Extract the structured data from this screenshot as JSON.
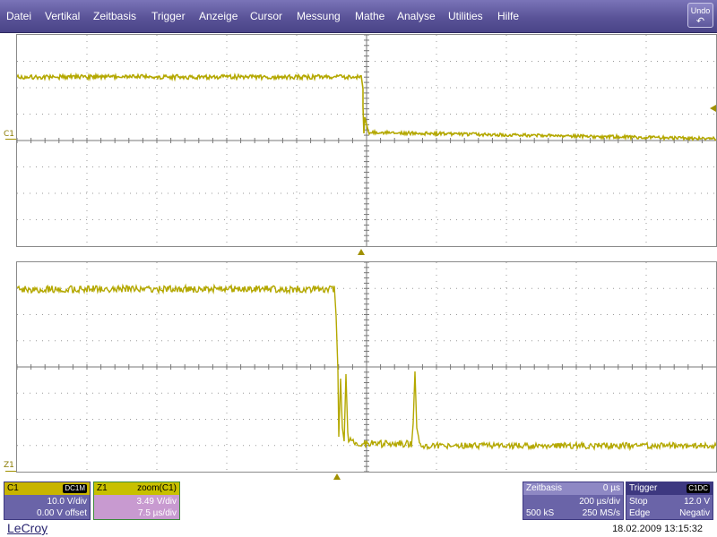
{
  "menu": [
    "Datei",
    "Vertikal",
    "Zeitbasis",
    "Trigger",
    "Anzeige",
    "Cursor",
    "Messung",
    "Mathe",
    "Analyse",
    "Utilities",
    "Hilfe"
  ],
  "undo_label": "Undo",
  "channel_labels": {
    "c1": "C1",
    "z1": "Z1"
  },
  "c1": {
    "name": "C1",
    "coupling": "DC1M",
    "scale": "10.0 V/div",
    "offset": "0.00 V offset"
  },
  "z1": {
    "name": "Z1",
    "source": "zoom(C1)",
    "scale": "3.49 V/div",
    "timebase": "7.5 µs/div"
  },
  "timebase": {
    "title": "Zeitbasis",
    "delay": "0 µs",
    "per_div": "200 µs/div",
    "samples": "500 kS",
    "rate": "250 MS/s"
  },
  "trigger": {
    "title": "Trigger",
    "source": "C1DC",
    "mode": "Stop",
    "level": "12.0 V",
    "type": "Edge",
    "slope": "Negativ"
  },
  "brand": "LeCroy",
  "timestamp": "18.02.2009 13:15:32",
  "colors": {
    "trace": "#b4a800",
    "menu": "#5a5398",
    "panel": "#6a64a8"
  }
}
